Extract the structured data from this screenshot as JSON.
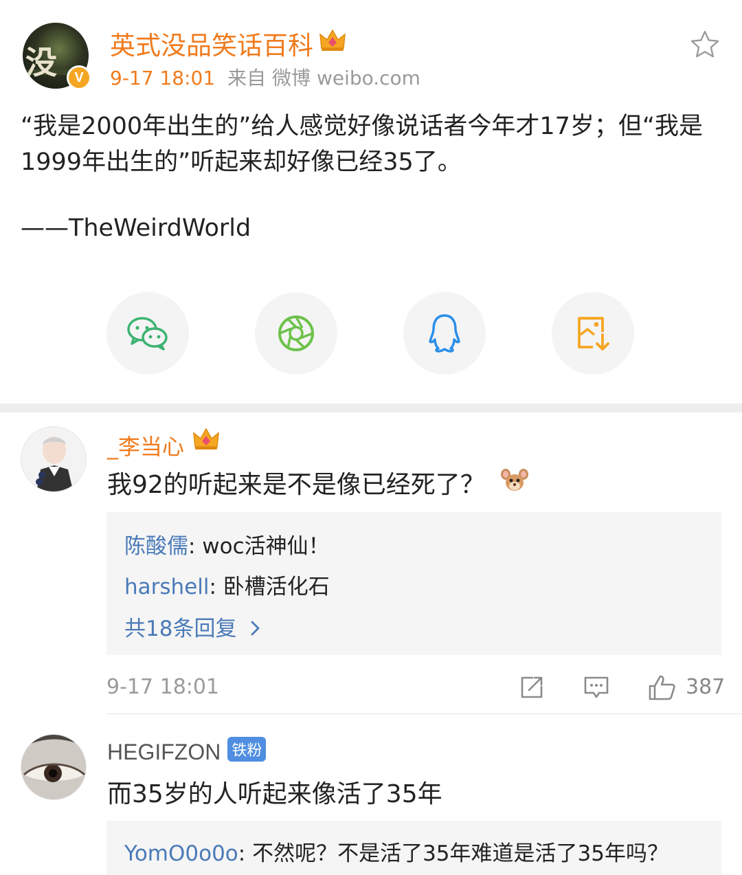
{
  "post": {
    "author": "英式没品笑话百科",
    "avatar_text": "没",
    "verified_badge": "V",
    "time": "9-17 18:01",
    "source": "来自 微博 weibo.com",
    "body": "“我是2000年出生的”给人感觉好像说话者今年才17岁；但“我是1999年出生的”听起来却好像已经35了。",
    "signature": "——TheWeirdWorld"
  },
  "share": {
    "items": [
      {
        "icon": "wechat-icon",
        "color": "#3cb371"
      },
      {
        "icon": "moments-icon",
        "color": "#6cc24a"
      },
      {
        "icon": "qq-icon",
        "color": "#2a8ee8"
      },
      {
        "icon": "save-image-icon",
        "color": "#f5a623"
      }
    ]
  },
  "comments": [
    {
      "user": "_李当心",
      "text": "我92的听起来是不是像已经死了？",
      "emoji": "jerry-mouse-emoji",
      "replies": [
        {
          "user": "陈酸儒",
          "text": ": woc活神仙！"
        },
        {
          "user": "harshell",
          "text": ": 卧槽活化石"
        }
      ],
      "more_replies": "共18条回复",
      "time": "9-17 18:01",
      "likes": "387"
    },
    {
      "user": "HEGIFZON",
      "badge": "铁粉",
      "text": "而35岁的人听起来像活了35年",
      "replies": [
        {
          "user": "YomO0o0o",
          "text": ": 不然呢？不是活了35年难道是活了35年吗？"
        }
      ]
    }
  ],
  "colors": {
    "brand_orange": "#f07b1d",
    "link_blue": "#4a7ab8",
    "muted_gray": "#9a9a9a",
    "fan_badge_blue": "#4f8ee0"
  }
}
